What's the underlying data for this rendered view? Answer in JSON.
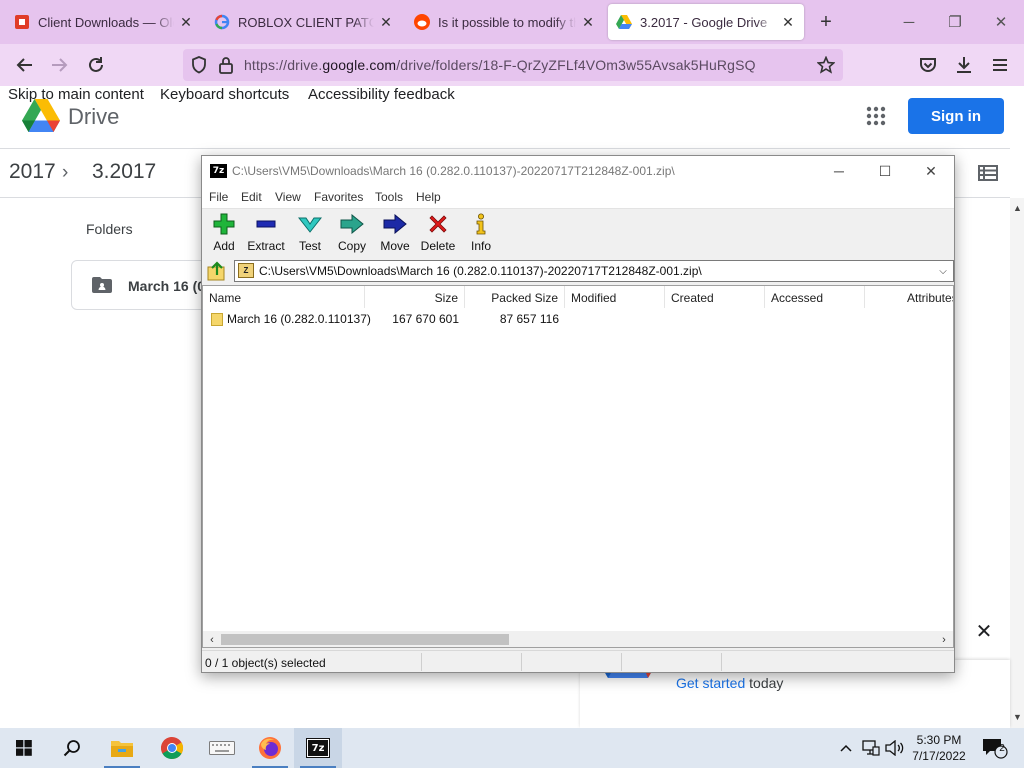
{
  "browser": {
    "tabs": [
      {
        "title": "Client Downloads — Old Roblox Revival",
        "favicon": "roblox-red-icon",
        "active": false
      },
      {
        "title": "ROBLOX CLIENT PATCHING",
        "favicon": "google-g-icon",
        "active": false
      },
      {
        "title": "Is it possible to modify the client",
        "favicon": "reddit-icon",
        "active": false
      },
      {
        "title": "3.2017 - Google Drive",
        "favicon": "drive-icon",
        "active": true
      }
    ],
    "new_tab_label": "+",
    "url_host_prefix": "https://drive.",
    "url_host": "google.com",
    "url_path": "/drive/folders/18-F-QrZyZFLf4VOm3w55Avsak5HuRgSQ",
    "colors": {
      "tabstrip": "#e6c4ee",
      "toolbar": "#f0d8f5"
    }
  },
  "drive": {
    "skip_links": [
      "Skip to main content",
      "Keyboard shortcuts",
      "Accessibility feedback"
    ],
    "product_name": "Drive",
    "signin_label": "Sign in",
    "breadcrumb": [
      "2017",
      "3.2017"
    ],
    "breadcrumb_sep": "›",
    "folders_label": "Folders",
    "folder_card_name": "March 16 (0.",
    "promo_link": "Get started",
    "promo_text": " today",
    "promo_close": "✕",
    "accent": "#1a73e8"
  },
  "sevenzip": {
    "app_icon": "7z",
    "title": "C:\\Users\\VM5\\Downloads\\March 16 (0.282.0.110137)-20220717T212848Z-001.zip\\",
    "menus": [
      "File",
      "Edit",
      "View",
      "Favorites",
      "Tools",
      "Help"
    ],
    "tools": [
      {
        "label": "Add",
        "icon": "plus-icon"
      },
      {
        "label": "Extract",
        "icon": "minus-icon"
      },
      {
        "label": "Test",
        "icon": "check-icon"
      },
      {
        "label": "Copy",
        "icon": "copy-arrow-icon"
      },
      {
        "label": "Move",
        "icon": "move-arrow-icon"
      },
      {
        "label": "Delete",
        "icon": "delete-x-icon"
      },
      {
        "label": "Info",
        "icon": "info-icon"
      }
    ],
    "address": "C:\\Users\\VM5\\Downloads\\March 16 (0.282.0.110137)-20220717T212848Z-001.zip\\",
    "columns": [
      "Name",
      "Size",
      "Packed Size",
      "Modified",
      "Created",
      "Accessed",
      "Attributes"
    ],
    "rows": [
      {
        "name": "March 16 (0.282.0.110137)",
        "size": "167 670 601",
        "packed": "87 657 116",
        "modified": "",
        "created": "",
        "accessed": "",
        "attributes": ""
      }
    ],
    "status": "0 / 1 object(s) selected"
  },
  "taskbar": {
    "apps": [
      "start-icon",
      "search-icon",
      "file-explorer-icon",
      "chrome-icon",
      "keyboard-icon",
      "firefox-icon",
      "sevenzip-icon"
    ],
    "clock_time": "5:30 PM",
    "clock_date": "7/17/2022",
    "notifications": "2"
  }
}
